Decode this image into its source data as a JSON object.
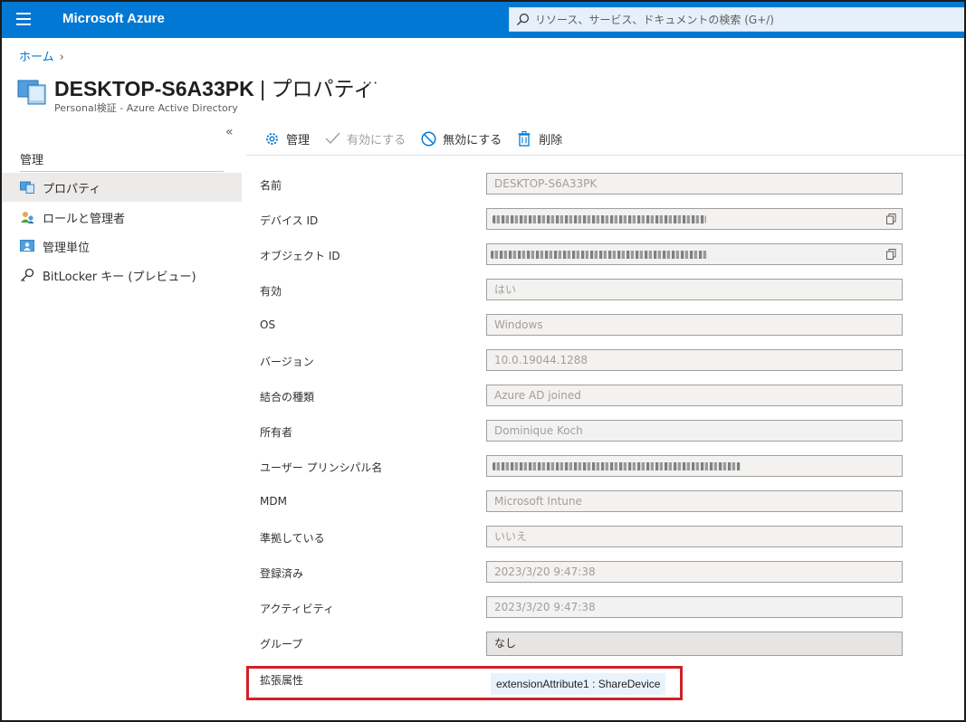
{
  "topbar": {
    "brand": "Microsoft Azure",
    "search_placeholder": "リソース、サービス、ドキュメントの検索 (G+/)"
  },
  "breadcrumb": {
    "home": "ホーム",
    "chevron": "›"
  },
  "header": {
    "title_main": "DESKTOP-S6A33PK",
    "title_sub": " | プロパティ",
    "more": "···",
    "subtitle": "Personal検証 - Azure Active Directory"
  },
  "nav": {
    "collapse": "«",
    "section": "管理",
    "items": [
      {
        "label": "プロパティ",
        "icon": "device-icon",
        "active": true
      },
      {
        "label": "ロールと管理者",
        "icon": "users-icon",
        "active": false
      },
      {
        "label": "管理単位",
        "icon": "admin-unit-icon",
        "active": false
      },
      {
        "label": "BitLocker キー (プレビュー)",
        "icon": "key-icon",
        "active": false
      }
    ]
  },
  "toolbar": {
    "manage": "管理",
    "enable": "有効にする",
    "disable": "無効にする",
    "delete": "削除"
  },
  "properties": [
    {
      "label": "名前",
      "value": "DESKTOP-S6A33PK"
    },
    {
      "label": "デバイス ID",
      "value": ""
    },
    {
      "label": "オブジェクト ID",
      "value": ""
    },
    {
      "label": "有効",
      "value": "はい"
    },
    {
      "label": "OS",
      "value": "Windows"
    },
    {
      "label": "バージョン",
      "value": "10.0.19044.1288"
    },
    {
      "label": "結合の種類",
      "value": "Azure AD joined"
    },
    {
      "label": "所有者",
      "value": "Dominique Koch"
    },
    {
      "label": "ユーザー プリンシパル名",
      "value": ""
    },
    {
      "label": "MDM",
      "value": "Microsoft Intune"
    },
    {
      "label": "準拠している",
      "value": "いいえ"
    },
    {
      "label": "登録済み",
      "value": "2023/3/20 9:47:38"
    },
    {
      "label": "アクティビティ",
      "value": "2023/3/20 9:47:38"
    },
    {
      "label": "グループ",
      "value": "なし"
    }
  ],
  "extension": {
    "label": "拡張属性",
    "value": "extensionAttribute1 : ShareDevice"
  },
  "colors": {
    "accent": "#0078d4",
    "highlight": "#d32027"
  }
}
